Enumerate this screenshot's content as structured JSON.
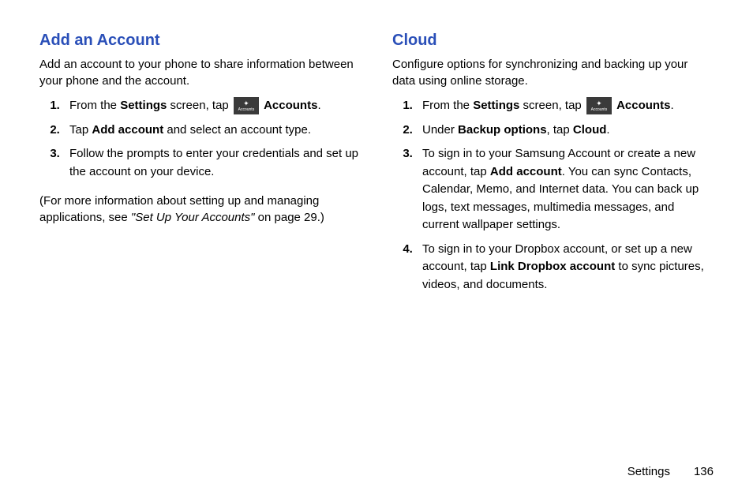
{
  "left": {
    "heading": "Add an Account",
    "intro": "Add an account to your phone to share information between your phone and the account.",
    "step1_a": "From the ",
    "step1_b": "Settings",
    "step1_c": " screen, tap ",
    "step1_d": "Accounts",
    "step1_e": ".",
    "step2_a": "Tap ",
    "step2_b": "Add account",
    "step2_c": " and select an account type.",
    "step3": "Follow the prompts to enter your credentials and set up the account on your device.",
    "note_a": "(For more information about setting up and managing applications, see ",
    "note_b": "\"Set Up Your Accounts\"",
    "note_c": " on page 29.)"
  },
  "right": {
    "heading": "Cloud",
    "intro": "Configure options for synchronizing and backing up your data using online storage.",
    "step1_a": "From the ",
    "step1_b": "Settings",
    "step1_c": " screen, tap ",
    "step1_d": "Accounts",
    "step1_e": ".",
    "step2_a": "Under ",
    "step2_b": "Backup options",
    "step2_c": ", tap ",
    "step2_d": "Cloud",
    "step2_e": ".",
    "step3_a": "To sign in to your Samsung Account or create a new account, tap ",
    "step3_b": "Add account",
    "step3_c": ". You can sync Contacts, Calendar, Memo, and Internet data. You can back up logs, text messages, multimedia messages, and current wallpaper settings.",
    "step4_a": "To sign in to your Dropbox account, or set up a new account, tap ",
    "step4_b": "Link Dropbox account",
    "step4_c": " to sync pictures, videos, and documents."
  },
  "icon": {
    "label": "Accounts"
  },
  "footer": {
    "section": "Settings",
    "page": "136"
  }
}
